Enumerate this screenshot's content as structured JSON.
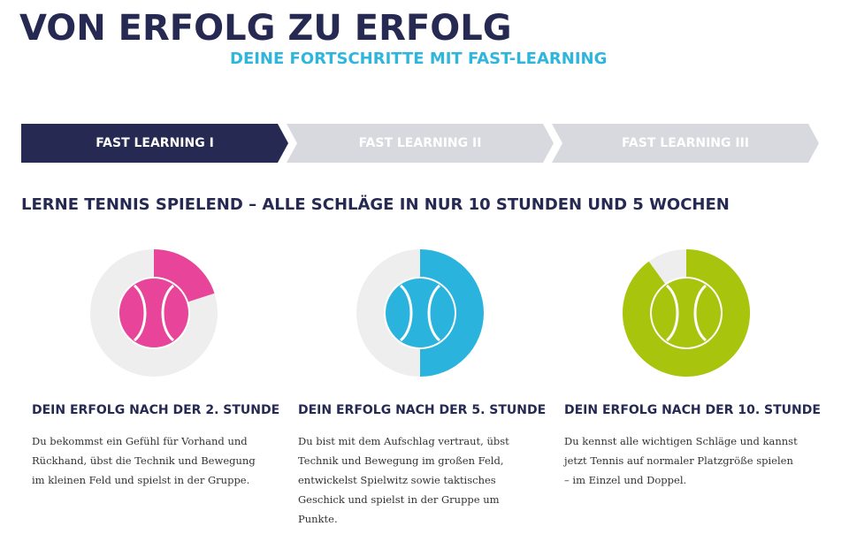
{
  "header": {
    "title": "VON ERFOLG ZU ERFOLG",
    "subtitle": "DEINE FORTSCHRITTE MIT FAST-LEARNING"
  },
  "steps": [
    {
      "label": "FAST LEARNING I",
      "active": true
    },
    {
      "label": "FAST LEARNING II",
      "active": false
    },
    {
      "label": "FAST LEARNING III",
      "active": false
    }
  ],
  "colors": {
    "navy": "#262a52",
    "inactive_step": "#d8d9de",
    "inactive_text": "#ffffff",
    "track": "#eeeeee",
    "pink": "#e8449a",
    "blue": "#2ab4dd",
    "green": "#a9c40d"
  },
  "section": {
    "heading": "LERNE TENNIS SPIELEND – ALLE SCHLÄGE IN NUR 10 STUNDEN UND 5 WOCHEN"
  },
  "progress": [
    {
      "title": "DEIN ERFOLG NACH DER 2. STUNDE",
      "text": "Du bekommst ein Gefühl für Vorhand und Rückhand, übst die Technik und Bewegung im kleinen Feld und spielst in der Gruppe.",
      "fraction": 0.2,
      "color": "#e8449a",
      "ball_icon": "tennis-ball-icon"
    },
    {
      "title": "DEIN ERFOLG NACH DER 5. STUNDE",
      "text": "Du bist mit dem Aufschlag vertraut, übst Technik und Bewegung im großen Feld, entwickelst Spielwitz sowie taktisches Geschick und spielst in der Gruppe um Punkte.",
      "fraction": 0.5,
      "color": "#2ab4dd",
      "ball_icon": "tennis-ball-icon"
    },
    {
      "title": "DEIN ERFOLG NACH DER 10. STUNDE",
      "text": "Du kennst alle wichtigen Schläge und kannst jetzt Tennis auf normaler Platzgröße spielen – im Einzel und Doppel.",
      "fraction": 0.9,
      "color": "#a9c40d",
      "ball_icon": "tennis-ball-icon"
    }
  ]
}
